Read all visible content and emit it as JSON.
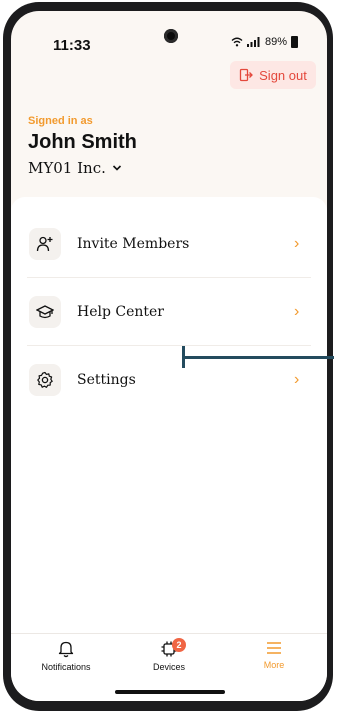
{
  "status_bar": {
    "time": "11:33",
    "battery": "89%"
  },
  "header": {
    "sign_out_label": "Sign out",
    "signed_in_label": "Signed in as",
    "user_name": "John Smith",
    "organization": "MY01 Inc."
  },
  "menu": {
    "items": [
      {
        "label": "Invite Members",
        "icon": "invite-user-icon"
      },
      {
        "label": "Help Center",
        "icon": "graduation-cap-icon"
      },
      {
        "label": "Settings",
        "icon": "gear-icon"
      }
    ]
  },
  "tabbar": {
    "tabs": [
      {
        "label": "Notifications",
        "icon": "bell-icon"
      },
      {
        "label": "Devices",
        "icon": "devices-icon",
        "badge": "2"
      },
      {
        "label": "More",
        "icon": "menu-icon",
        "active": true
      }
    ]
  },
  "colors": {
    "accent": "#f29a2e",
    "danger": "#e4483c",
    "annotation": "#234b5e"
  }
}
